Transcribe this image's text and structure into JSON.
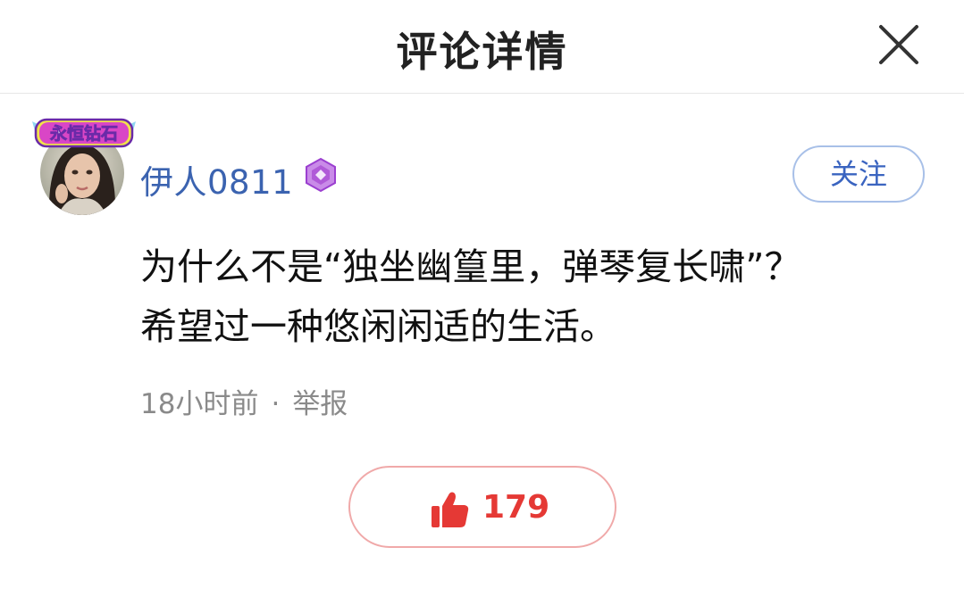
{
  "header": {
    "title": "评论详情"
  },
  "user": {
    "badge_text": "永恒钻石",
    "name": "伊人0811",
    "follow_label": "关注"
  },
  "comment": {
    "line1": "为什么不是“独坐幽篁里，弹琴复长啸”？",
    "line2": "希望过一种悠闲闲适的生活。"
  },
  "meta": {
    "time": "18小时前",
    "separator": "·",
    "report_label": "举报"
  },
  "like": {
    "count": "179"
  },
  "colors": {
    "username": "#3b63b0",
    "follow": "#3a64c0",
    "like": "#e53935",
    "level_icon": "#b05ad8"
  },
  "icons": {
    "close": "close-icon",
    "level": "diamond-level-icon",
    "like": "thumbs-up-icon"
  }
}
